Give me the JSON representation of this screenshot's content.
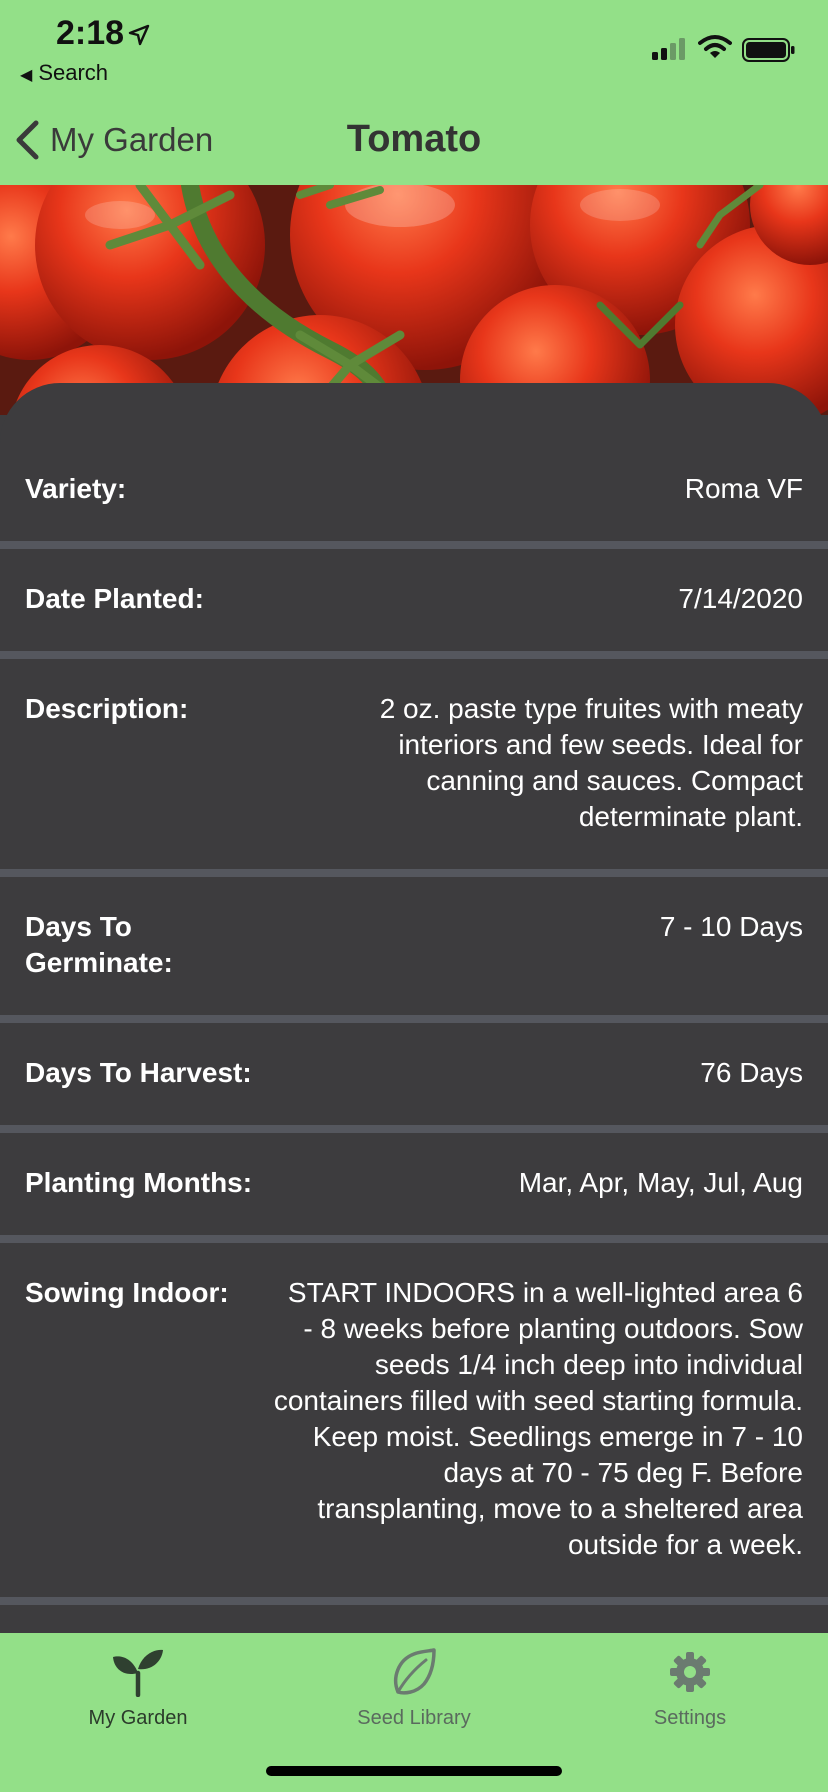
{
  "status": {
    "time": "2:18",
    "back_app": "Search"
  },
  "nav": {
    "back_label": "My Garden",
    "title": "Tomato"
  },
  "details": [
    {
      "label": "Variety:",
      "value": "Roma VF"
    },
    {
      "label": "Date Planted:",
      "value": "7/14/2020"
    },
    {
      "label": "Description:",
      "value": "2 oz. paste type fruites with meaty interiors and few seeds. Ideal for canning and sauces. Compact determinate plant."
    },
    {
      "label": "Days To Germinate:",
      "value": "7 - 10 Days"
    },
    {
      "label": "Days To Harvest:",
      "value": "76 Days"
    },
    {
      "label": "Planting Months:",
      "value": "Mar, Apr, May, Jul, Aug"
    },
    {
      "label": "Sowing Indoor:",
      "value": "START INDOORS in a well-lighted area 6 - 8 weeks before planting outdoors. Sow seeds 1/4 inch deep into individual containers filled with seed starting formula. Keep moist. Seedlings emerge in 7 - 10 days at 70 - 75 deg F. Before transplanting, move to a sheltered area outside for a week."
    }
  ],
  "tabs": [
    {
      "label": "My Garden",
      "icon": "sprout-icon",
      "active": true
    },
    {
      "label": "Seed Library",
      "icon": "leaf-icon",
      "active": false
    },
    {
      "label": "Settings",
      "icon": "gear-icon",
      "active": false
    }
  ],
  "colors": {
    "accent": "#93e088",
    "sheet": "#3d3c3e",
    "divider": "#55575e"
  }
}
